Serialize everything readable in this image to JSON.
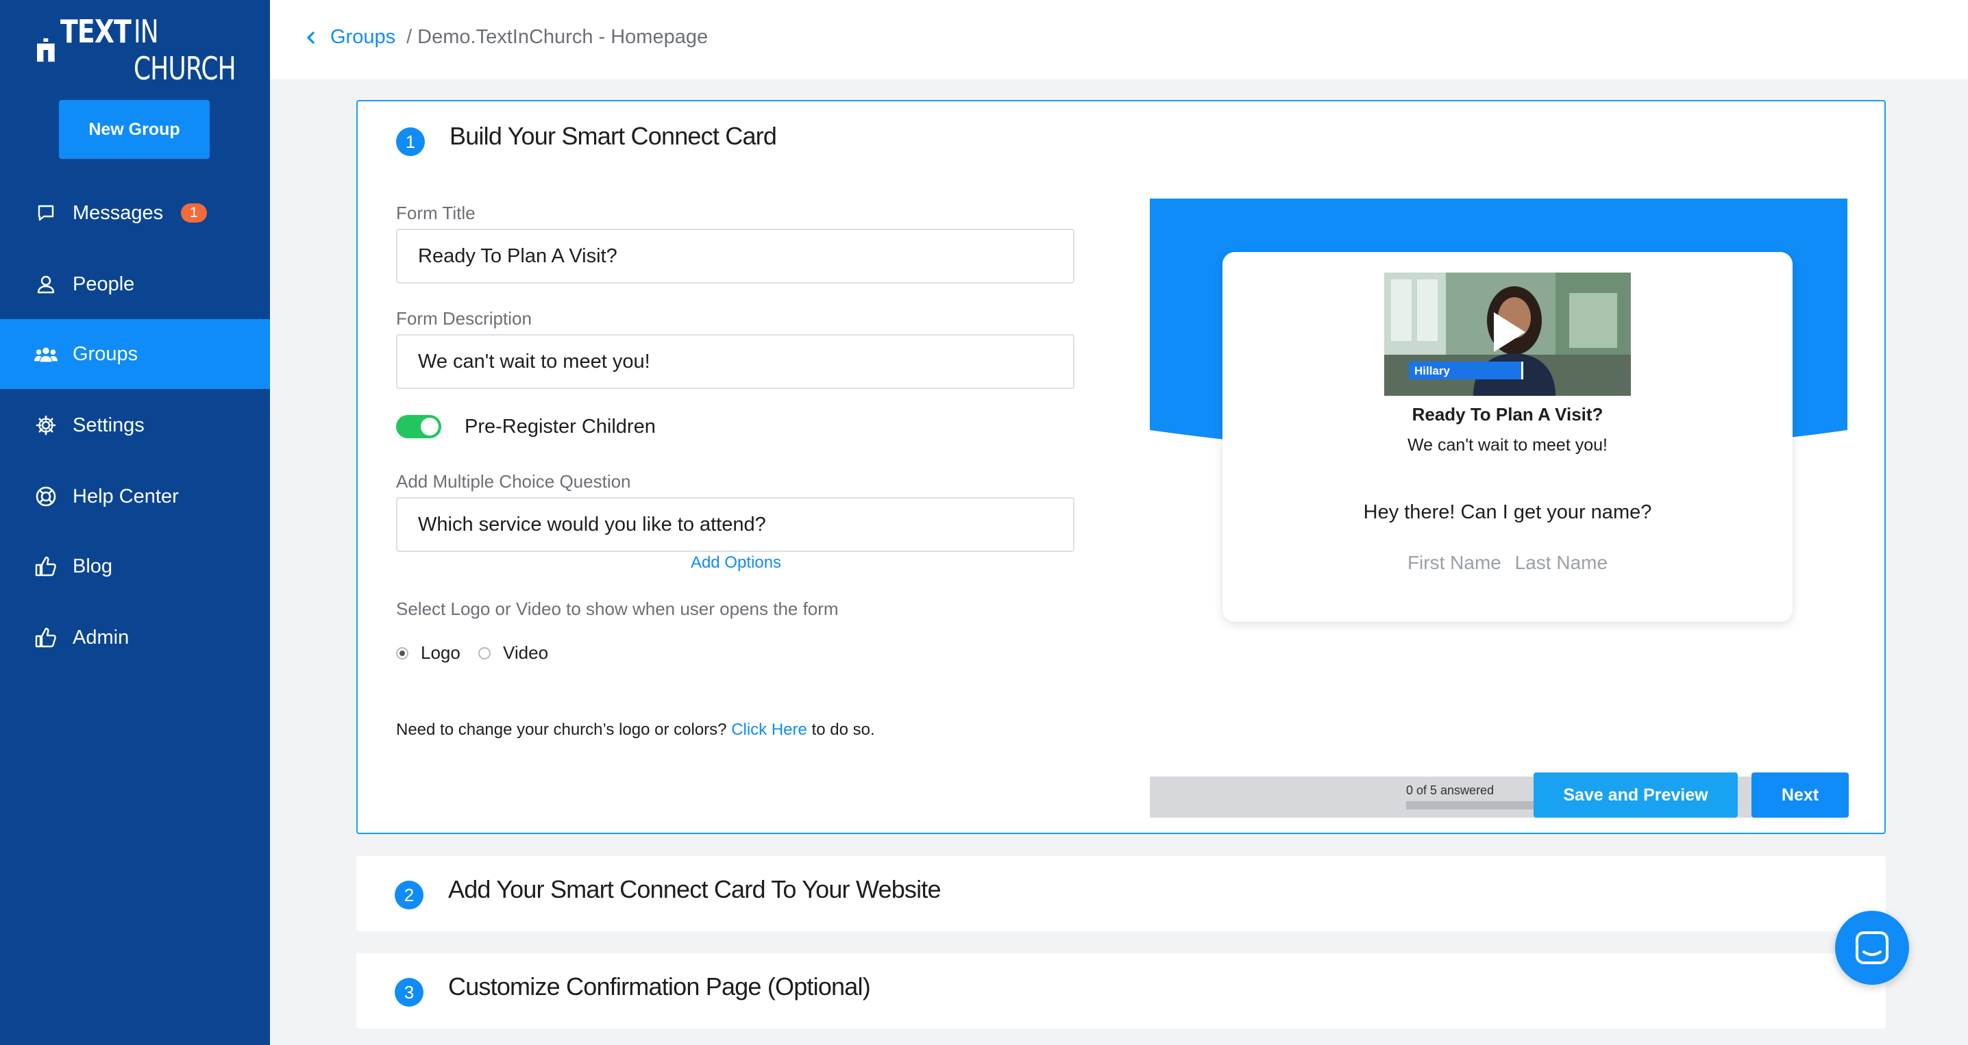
{
  "brand": {
    "name_bold": "TEXT",
    "name_thin": "IN CHURCH",
    "accent": "#0f8cf7",
    "sidebar_bg": "#0b4592"
  },
  "sidebar": {
    "new_group_label": "New Group",
    "items": [
      {
        "label": "Messages",
        "icon": "chat-bubble-icon",
        "badge": "1"
      },
      {
        "label": "People",
        "icon": "person-icon"
      },
      {
        "label": "Groups",
        "icon": "people-group-icon",
        "active": true
      },
      {
        "label": "Settings",
        "icon": "gear-icon"
      },
      {
        "label": "Help Center",
        "icon": "lifebuoy-icon"
      },
      {
        "label": "Blog",
        "icon": "thumbs-up-icon"
      },
      {
        "label": "Admin",
        "icon": "thumbs-up-icon"
      }
    ]
  },
  "breadcrumb": {
    "parent": "Groups",
    "separator": "/",
    "current": "Demo.TextInChurch - Homepage"
  },
  "step1": {
    "number": "1",
    "title": "Build Your Smart Connect Card",
    "form_title_label": "Form Title",
    "form_title_value": "Ready To Plan A Visit?",
    "form_description_label": "Form Description",
    "form_description_value": "We can't wait to meet you!",
    "pre_register_label": "Pre-Register Children",
    "pre_register_on": true,
    "mc_question_label": "Add Multiple Choice Question",
    "mc_question_value": "Which service would you like to attend?",
    "add_options_label": "Add Options",
    "logo_video_label": "Select Logo or Video to show when user opens the form",
    "radio_logo": "Logo",
    "radio_video": "Video",
    "selected": "Logo",
    "helper_before": "Need to change your church’s logo or colors?",
    "helper_link": "Click Here",
    "helper_after": "to do so.",
    "save_preview_label": "Save and Preview",
    "next_label": "Next"
  },
  "preview": {
    "video_name_tag": "Hillary",
    "title": "Ready To Plan A Visit?",
    "description": "We can't wait to meet you!",
    "question": "Hey there! Can I get your name?",
    "first_name_placeholder": "First Name",
    "last_name_placeholder": "Last Name",
    "progress_text": "0 of 5 answered",
    "progress_fraction": 0
  },
  "step2": {
    "number": "2",
    "title": "Add Your Smart Connect Card To Your Website"
  },
  "step3": {
    "number": "3",
    "title": "Customize Confirmation Page (Optional)"
  }
}
